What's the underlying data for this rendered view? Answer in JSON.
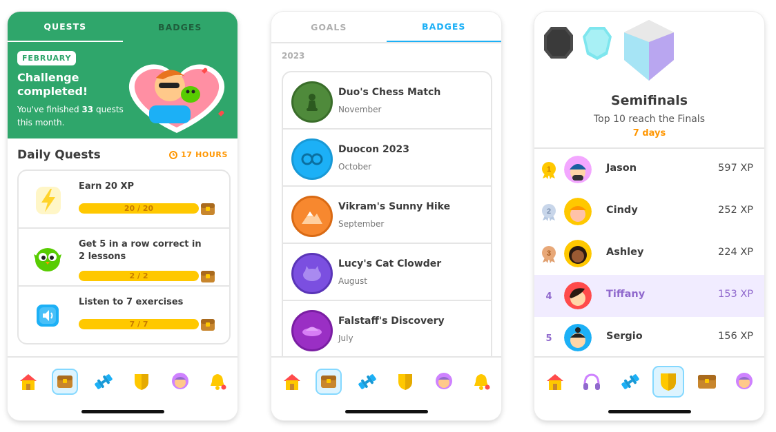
{
  "screen1": {
    "tabs": [
      "QUESTS",
      "BADGES"
    ],
    "challenge": {
      "month": "FEBRUARY",
      "title": "Challenge completed!",
      "sub_prefix": "You've finished ",
      "count": "33",
      "sub_suffix": " quests this month."
    },
    "daily": {
      "title": "Daily Quests",
      "timer": "17 HOURS",
      "quests": [
        {
          "label": "Earn 20 XP",
          "progress": "20 / 20",
          "fraction": 1.0
        },
        {
          "label": "Get 5 in a row correct in 2 lessons",
          "progress": "2 / 2",
          "fraction": 1.0
        },
        {
          "label": "Listen to 7 exercises",
          "progress": "7 / 7",
          "fraction": 1.0
        }
      ]
    }
  },
  "screen2": {
    "tabs": [
      "GOALS",
      "BADGES"
    ],
    "year": "2023",
    "badges": [
      {
        "name": "Duo's Chess Match",
        "month": "November",
        "color": "#4f8a3b"
      },
      {
        "name": "Duocon 2023",
        "month": "October",
        "color": "#1cb0f6"
      },
      {
        "name": "Vikram's Sunny Hike",
        "month": "September",
        "color": "#f7882f"
      },
      {
        "name": "Lucy's Cat Clowder",
        "month": "August",
        "color": "#7b4fe0"
      },
      {
        "name": "Falstaff's Discovery",
        "month": "July",
        "color": "#9a2fc4"
      }
    ]
  },
  "screen3": {
    "league": "Semifinals",
    "subtitle": "Top 10 reach the Finals",
    "days": "7 days",
    "leaders": [
      {
        "rank": "1",
        "name": "Jason",
        "xp": "597 XP"
      },
      {
        "rank": "2",
        "name": "Cindy",
        "xp": "252 XP"
      },
      {
        "rank": "3",
        "name": "Ashley",
        "xp": "224 XP"
      },
      {
        "rank": "4",
        "name": "Tiffany",
        "xp": "153 XP"
      },
      {
        "rank": "5",
        "name": "Sergio",
        "xp": "156 XP"
      }
    ]
  },
  "colors": {
    "green": "#2fa66b",
    "blue": "#1cb0f6",
    "gold": "#ffc800",
    "orange": "#ff9600",
    "purple": "#9069cd"
  },
  "icons": [
    "home-icon",
    "quests-chest-icon",
    "dumbbell-icon",
    "shield-icon",
    "profile-icon",
    "bell-icon",
    "headphones-icon"
  ]
}
